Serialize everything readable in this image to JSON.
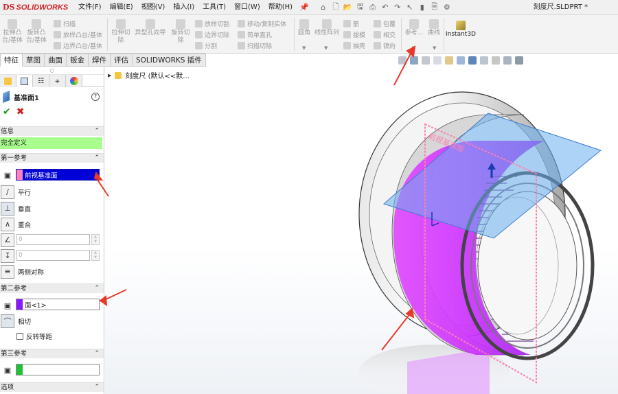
{
  "app": {
    "logo_prefix": "DS",
    "logo_text": "SOLIDWORKS",
    "doc_title": "刻度尺.SLDPRT *",
    "menus": [
      "文件(F)",
      "编辑(E)",
      "视图(V)",
      "插入(I)",
      "工具(T)",
      "窗口(W)",
      "帮助(H)"
    ]
  },
  "commands": {
    "extrude_boss": "拉伸凸台/基体",
    "revolve_boss": "旋转凸台/基体",
    "sweep": "扫描",
    "loft_boss": "放样凸台/基体",
    "boundary_boss": "边界凸台/基体",
    "extrude_cut": "拉伸切除",
    "hole_wizard": "异型孔向导",
    "revolve_cut": "旋转切除",
    "loft_cut": "放样切割",
    "boundary_cut": "边界切除",
    "split": "分割",
    "move_copy": "移动/复制实体",
    "simple_hole": "简单直孔",
    "swept_cut": "扫描切除",
    "fillet": "圆角",
    "linear_pattern": "线性阵列",
    "rib": "筋",
    "draft": "拔模",
    "shell": "抽壳",
    "wrap": "包覆",
    "intersect": "相交",
    "mirror": "镜向",
    "reference": "参考...",
    "curves": "曲线",
    "instant3d": "Instant3D"
  },
  "tabs": [
    "特征",
    "草图",
    "曲面",
    "钣金",
    "焊件",
    "评估",
    "SOLIDWORKS 插件"
  ],
  "tree": {
    "root_label": "刻度尺  (默认<<默..."
  },
  "property_manager": {
    "title": "基准面1",
    "info_header": "信息",
    "status": "完全定义",
    "first_ref": {
      "header": "第一参考",
      "selection": "前视基准面",
      "swatch_color": "#ff80c0",
      "options": [
        "平行",
        "垂直",
        "重合"
      ],
      "angle_value": "0",
      "offset_value": "0",
      "symmetric": "两侧对称"
    },
    "second_ref": {
      "header": "第二参考",
      "selection": "面<1>",
      "swatch_color": "#8a18ff",
      "option": "相切",
      "flip_offset": "反转等距"
    },
    "third_ref": {
      "header": "第三参考",
      "swatch_color": "#22c03a"
    },
    "options_header": "选项"
  },
  "viewport": {
    "plane_label": "前视基准面",
    "colors": {
      "selected_face": "#cc33ff",
      "preview_plane": "#6aaef0",
      "front_plane": "#ff7fb3",
      "arrow": "#e83a2a"
    }
  }
}
